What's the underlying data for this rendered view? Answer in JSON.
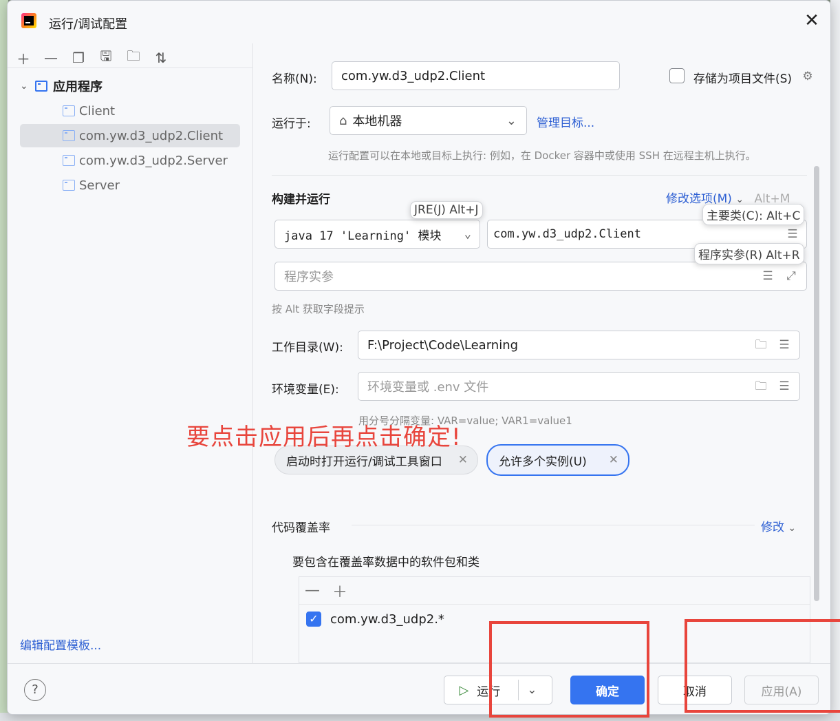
{
  "window": {
    "title": "运行/调试配置",
    "close_icon": "close-icon"
  },
  "toolbar": {
    "icons": [
      "add-icon",
      "remove-icon",
      "copy-icon",
      "save-icon",
      "new-folder-icon",
      "sort-icon"
    ]
  },
  "tree": {
    "root": {
      "label": "应用程序"
    },
    "items": [
      {
        "label": "Client"
      },
      {
        "label": "com.yw.d3_udp2.Client"
      },
      {
        "label": "com.yw.d3_udp2.Server"
      },
      {
        "label": "Server"
      }
    ],
    "edit_templates": "编辑配置模板..."
  },
  "form": {
    "name_label": "名称(N):",
    "name_value": "com.yw.d3_udp2.Client",
    "store_label": "存储为项目文件(S)",
    "run_on_label": "运行于:",
    "run_on_value": "本地机器",
    "manage_targets": "管理目标...",
    "run_on_hint": "运行配置可以在本地或目标上执行: 例如，在 Docker 容器中或使用 SSH 在远程主机上执行。",
    "build_run_title": "构建并运行",
    "modify_options": "修改选项(M)",
    "modify_shortcut": "Alt+M",
    "jre_value": "java 17 'Learning' 模块",
    "main_class_value": "com.yw.d3_udp2.Client",
    "program_args_placeholder": "程序实参",
    "alt_hint": "按 Alt 获取字段提示",
    "workdir_label": "工作目录(W):",
    "workdir_value": "F:\\Project\\Code\\Learning",
    "env_label": "环境变量(E):",
    "env_placeholder": "环境变量或 .env 文件",
    "env_hint": "用分号分隔变量: VAR=value; VAR1=value1",
    "popups": {
      "jre": "JRE(J) Alt+J",
      "main_class": "主要类(C): Alt+C",
      "program_args": "程序实参(R) Alt+R"
    },
    "chips": [
      {
        "label": "启动时打开运行/调试工具窗口",
        "active": false
      },
      {
        "label": "允许多个实例(U)",
        "active": true
      }
    ],
    "annotation": "要点击应用后再点击确定!",
    "coverage_title": "代码覆盖率",
    "coverage_modify": "修改",
    "coverage_subtitle": "要包含在覆盖率数据中的软件包和类",
    "coverage_entry": "com.yw.d3_udp2.*",
    "coverage_checked": true
  },
  "footer": {
    "help": "?",
    "run": "运行",
    "ok": "确定",
    "cancel": "取消",
    "apply": "应用(A)"
  },
  "colors": {
    "accent": "#3574f0",
    "annotation_red": "#e8453c",
    "link": "#2d5fd3"
  }
}
